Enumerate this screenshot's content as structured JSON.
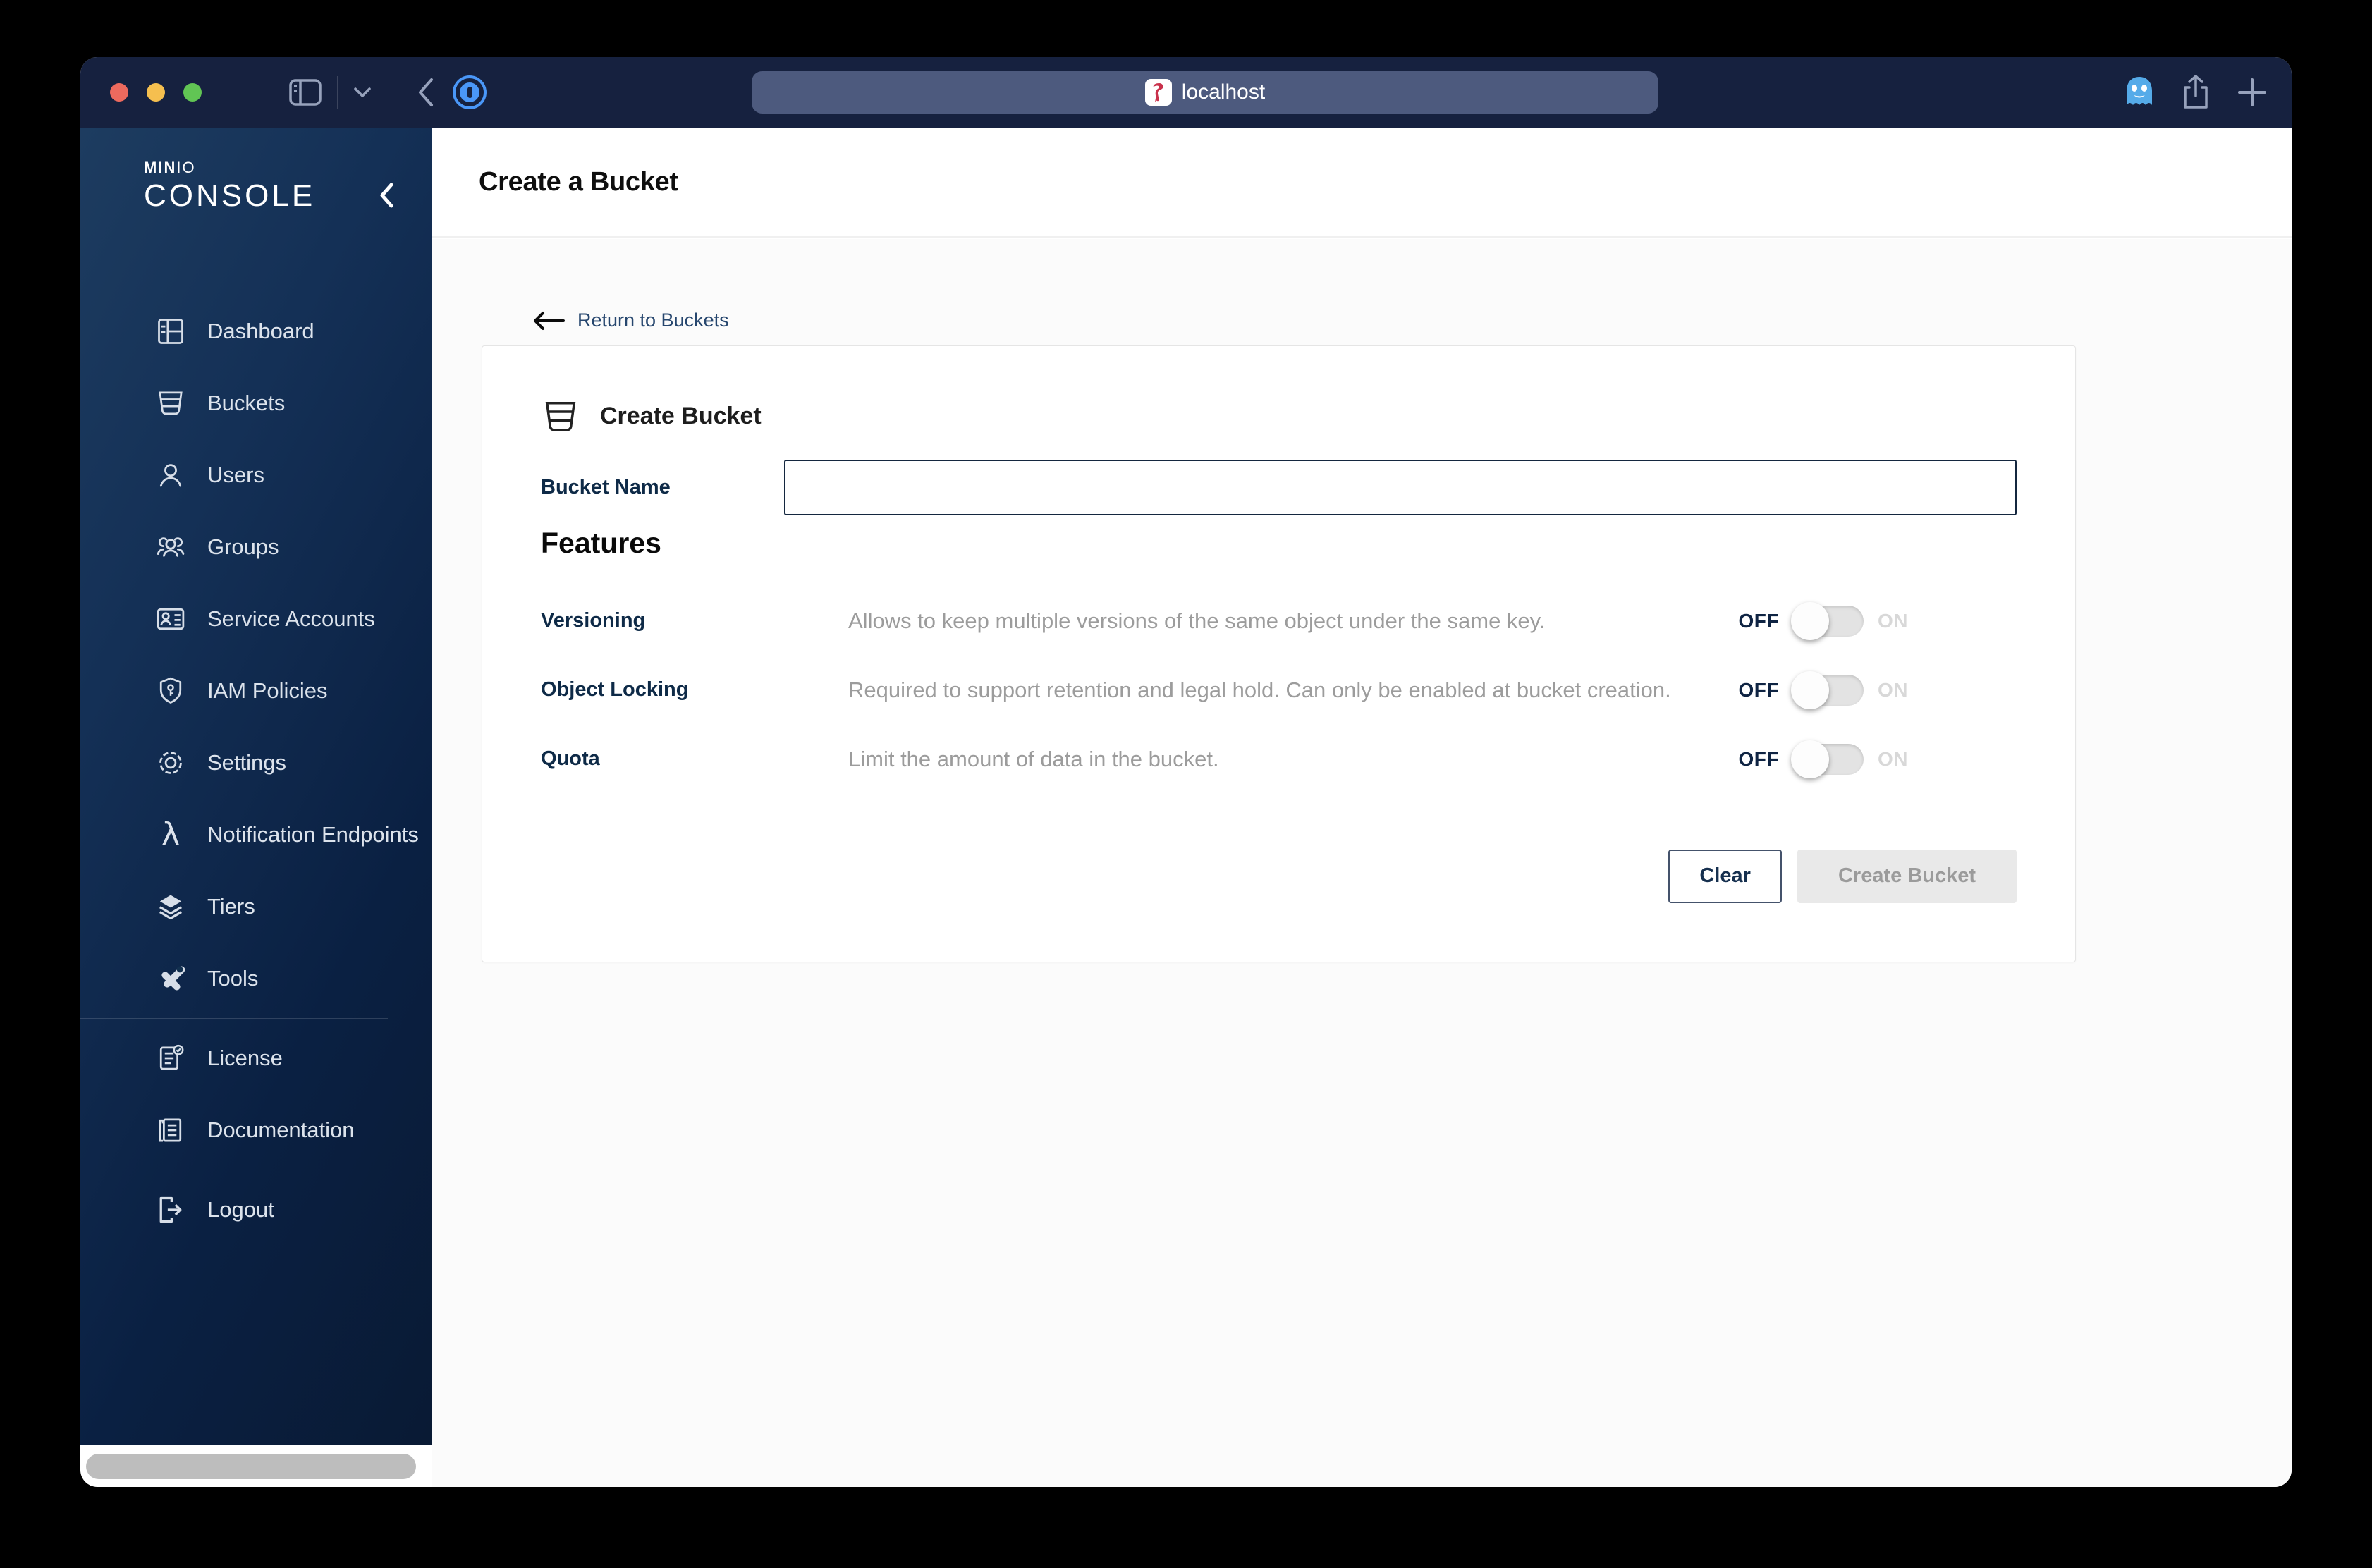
{
  "browser": {
    "address": "localhost",
    "favicon": "minio-flamingo-icon",
    "traffic_light_colors": {
      "close": "#ED6A5E",
      "minimize": "#F5BF4F",
      "zoom": "#61C554"
    },
    "titlebar_color": "#16213F",
    "urlbar_color": "#4D5A7E",
    "onepassword_blue": "#4A97F8",
    "ghostery_blue": "#55ABE9"
  },
  "sidebar": {
    "brand": {
      "bold": "MIN",
      "light": "IO",
      "product": "CONSOLE"
    },
    "gradient": [
      "#1d3c60",
      "#091a34"
    ],
    "items": [
      {
        "label": "Dashboard",
        "icon": "dashboard-icon"
      },
      {
        "label": "Buckets",
        "icon": "buckets-icon"
      },
      {
        "label": "Users",
        "icon": "users-icon"
      },
      {
        "label": "Groups",
        "icon": "groups-icon"
      },
      {
        "label": "Service Accounts",
        "icon": "service-accounts-icon"
      },
      {
        "label": "IAM Policies",
        "icon": "iam-policies-icon"
      },
      {
        "label": "Settings",
        "icon": "settings-icon"
      },
      {
        "label": "Notification Endpoints",
        "icon": "lambda-icon"
      },
      {
        "label": "Tiers",
        "icon": "tiers-icon"
      },
      {
        "label": "Tools",
        "icon": "tools-icon"
      },
      {
        "label": "License",
        "icon": "license-icon"
      },
      {
        "label": "Documentation",
        "icon": "documentation-icon"
      },
      {
        "label": "Logout",
        "icon": "logout-icon"
      }
    ]
  },
  "header": {
    "title": "Create a Bucket"
  },
  "main": {
    "back_link": {
      "label": "Return to Buckets",
      "icon": "left-arrow-icon"
    },
    "card": {
      "title": "Create Bucket",
      "title_icon": "bucket-icon",
      "bucket_name": {
        "label": "Bucket Name",
        "value": ""
      },
      "features_title": "Features",
      "toggle": {
        "off": "OFF",
        "on": "ON"
      },
      "features": [
        {
          "label": "Versioning",
          "description": "Allows to keep multiple versions of the same object under the same key.",
          "enabled": false
        },
        {
          "label": "Object Locking",
          "description": "Required to support retention and legal hold. Can only be enabled at bucket creation.",
          "enabled": false
        },
        {
          "label": "Quota",
          "description": "Limit the amount of data in the bucket.",
          "enabled": false
        }
      ],
      "actions": {
        "clear": "Clear",
        "create": "Create Bucket"
      }
    },
    "label_navy": "#0E2A47",
    "description_gray": "#9c9c9c",
    "link_blue": "#26466E",
    "disabled_button_bg": "#e9e9e9"
  }
}
